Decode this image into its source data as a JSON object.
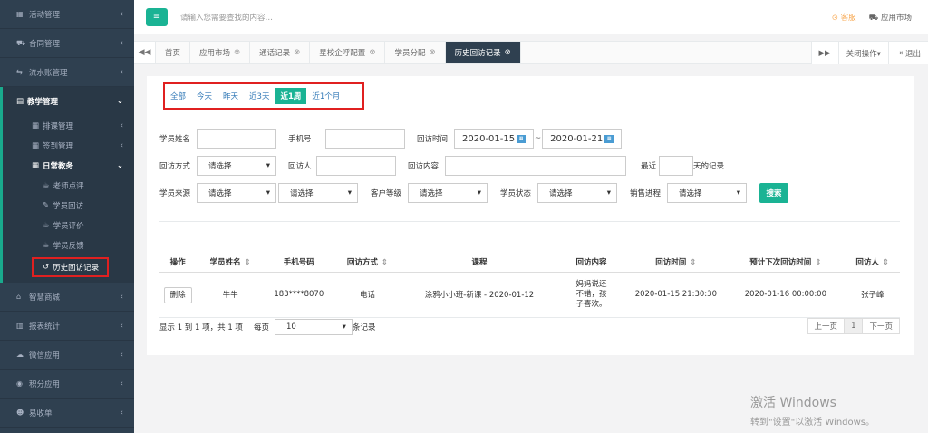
{
  "sidebar": {
    "items_top": [
      {
        "icon": "map-icon",
        "glyph": "▦",
        "label": "活动管理"
      },
      {
        "icon": "cart-icon",
        "glyph": "⛟",
        "label": "合同管理"
      },
      {
        "icon": "exchange-icon",
        "glyph": "⇆",
        "label": "流水账管理"
      }
    ],
    "active_group": {
      "icon": "book-icon",
      "glyph": "▤",
      "label": "教学管理"
    },
    "subgroups": [
      {
        "label": "排课管理",
        "icon": "calendar-icon",
        "glyph": "▦"
      },
      {
        "label": "签到管理",
        "icon": "calendar-icon",
        "glyph": "▦"
      }
    ],
    "daily": {
      "label": "日常教务",
      "icon": "calendar-icon",
      "glyph": "▦"
    },
    "daily_items": [
      {
        "label": "老师点评",
        "icon": "cup-icon",
        "glyph": "☕"
      },
      {
        "label": "学员回访",
        "icon": "edit-icon",
        "glyph": "✎"
      },
      {
        "label": "学员评价",
        "icon": "cup-icon",
        "glyph": "☕"
      },
      {
        "label": "学员反馈",
        "icon": "cup-icon",
        "glyph": "☕"
      },
      {
        "label": "历史回访记录",
        "icon": "history-icon",
        "glyph": "↺"
      }
    ],
    "items_bottom": [
      {
        "icon": "shop-icon",
        "glyph": "⌂",
        "label": "智慧商城"
      },
      {
        "icon": "chart-icon",
        "glyph": "▥",
        "label": "报表统计"
      },
      {
        "icon": "wechat-icon",
        "glyph": "☁",
        "label": "微信应用"
      },
      {
        "icon": "points-icon",
        "glyph": "◉",
        "label": "积分应用"
      },
      {
        "icon": "users-icon",
        "glyph": "☻",
        "label": "易收单"
      }
    ]
  },
  "topbar": {
    "search_placeholder": "请输入您需要查找的内容…",
    "service_label": "客服",
    "market_label": "应用市场"
  },
  "tabs": {
    "items": [
      {
        "label": "首页",
        "closable": false
      },
      {
        "label": "应用市场",
        "closable": true
      },
      {
        "label": "通话记录",
        "closable": true
      },
      {
        "label": "星校企呼配置",
        "closable": true
      },
      {
        "label": "学员分配",
        "closable": true
      },
      {
        "label": "历史回访记录",
        "closable": true,
        "active": true
      }
    ],
    "close_ops": "关闭操作▾",
    "logout": "退出"
  },
  "filter": [
    "全部",
    "今天",
    "昨天",
    "近3天",
    "近1周",
    "近1个月"
  ],
  "filter_active_index": 4,
  "form": {
    "student_name": "学员姓名",
    "phone": "手机号",
    "visit_time": "回访时间",
    "date_from": "2020-01-15",
    "date_sep": "~",
    "date_to": "2020-01-21",
    "visit_method": "回访方式",
    "visitor": "回访人",
    "visit_content": "回访内容",
    "recent": "最近",
    "days_record": "天的记录",
    "student_source": "学员来源",
    "customer_level": "客户等级",
    "student_status": "学员状态",
    "sales_progress": "销售进程",
    "select_placeholder": "请选择",
    "search_button": "搜索"
  },
  "table": {
    "headers": [
      "操作",
      "学员姓名",
      "手机号码",
      "回访方式",
      "课程",
      "回访内容",
      "回访时间",
      "预计下次回访时间",
      "回访人"
    ],
    "rows": [
      {
        "action": "删除",
        "name": "牛牛",
        "phone": "183****8070",
        "method": "电话",
        "course": "涂鸦小小班-新课 - 2020-01-12",
        "content": "妈妈说还不错，孩子喜欢。",
        "time": "2020-01-15 21:30:30",
        "next_time": "2020-01-16 00:00:00",
        "visitor": "张子峰"
      }
    ]
  },
  "footer": {
    "summary": "显示 1 到 1 项，共 1 项",
    "per_page": "每页",
    "page_size": "10",
    "records": "条记录",
    "prev": "上一页",
    "current": "1",
    "next": "下一页"
  },
  "watermark": {
    "line1": "激活 Windows",
    "line2": "转到\"设置\"以激活 Windows。"
  },
  "colors": {
    "accent": "#1ab394",
    "sidebar": "#2f4050",
    "highlight": "#e02020"
  }
}
